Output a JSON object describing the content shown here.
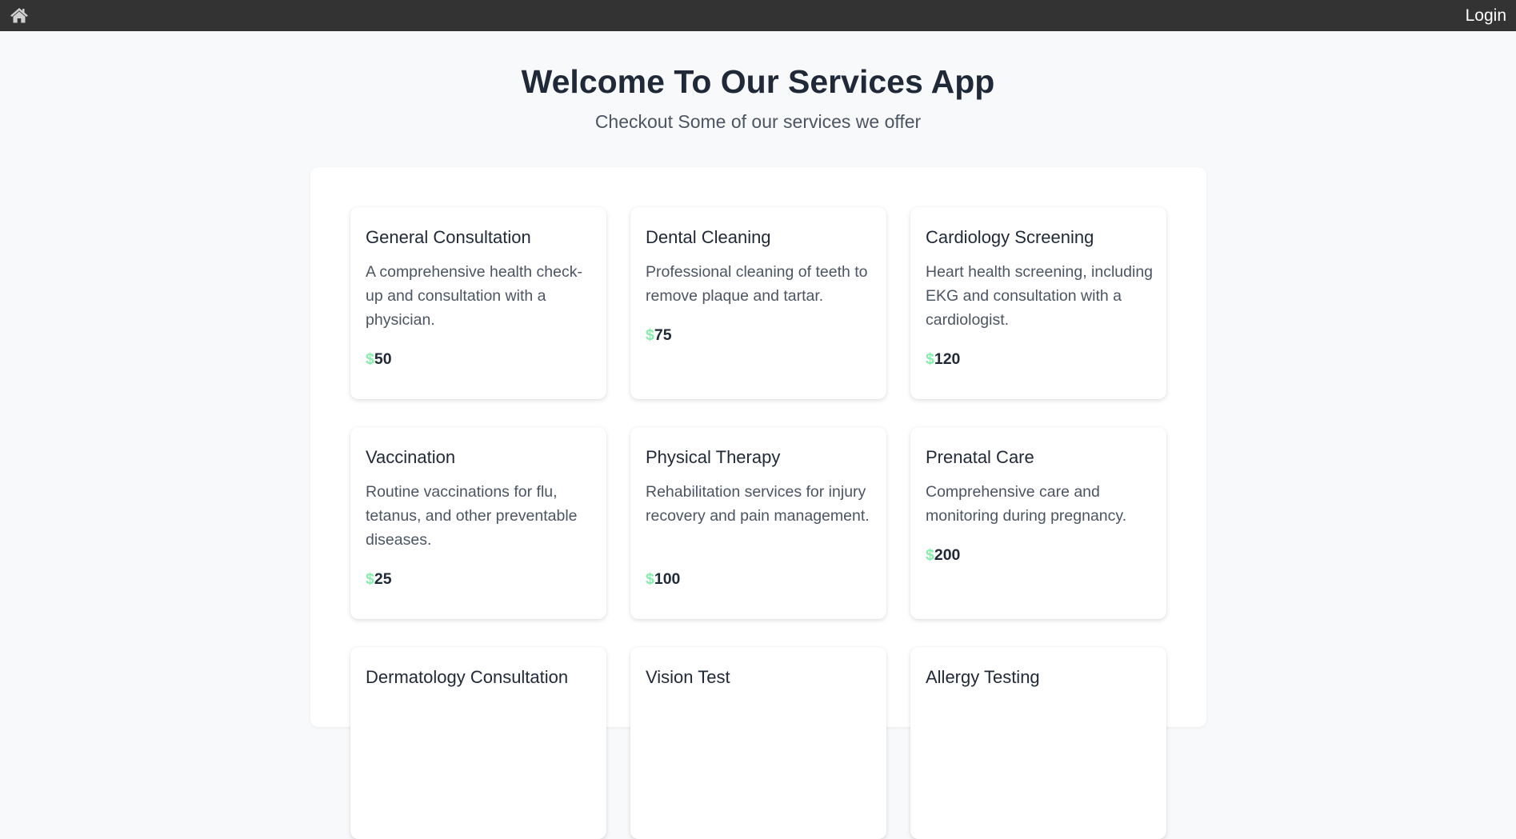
{
  "nav": {
    "home_icon": "home-icon",
    "login_label": "Login"
  },
  "hero": {
    "title": "Welcome To Our Services App",
    "subtitle": "Checkout Some of our services we offer"
  },
  "currency_symbol": "$",
  "colors": {
    "navbar": "#333333",
    "dollar_accent": "#86efac",
    "page_background": "#f8f9fb"
  },
  "services": [
    {
      "title": "General Consultation",
      "description": "A comprehensive health check-up and consultation with a physician.",
      "price": "50"
    },
    {
      "title": "Dental Cleaning",
      "description": "Professional cleaning of teeth to remove plaque and tartar.",
      "price": "75"
    },
    {
      "title": "Cardiology Screening",
      "description": "Heart health screening, including EKG and consultation with a cardiologist.",
      "price": "120"
    },
    {
      "title": "Vaccination",
      "description": "Routine vaccinations for flu, tetanus, and other preventable diseases.",
      "price": "25"
    },
    {
      "title": "Physical Therapy",
      "description": "Rehabilitation services for injury recovery and pain management.",
      "price": "100"
    },
    {
      "title": "Prenatal Care",
      "description": "Comprehensive care and monitoring during pregnancy.",
      "price": "200"
    },
    {
      "title": "Dermatology Consultation"
    },
    {
      "title": "Vision Test"
    },
    {
      "title": "Allergy Testing"
    }
  ]
}
